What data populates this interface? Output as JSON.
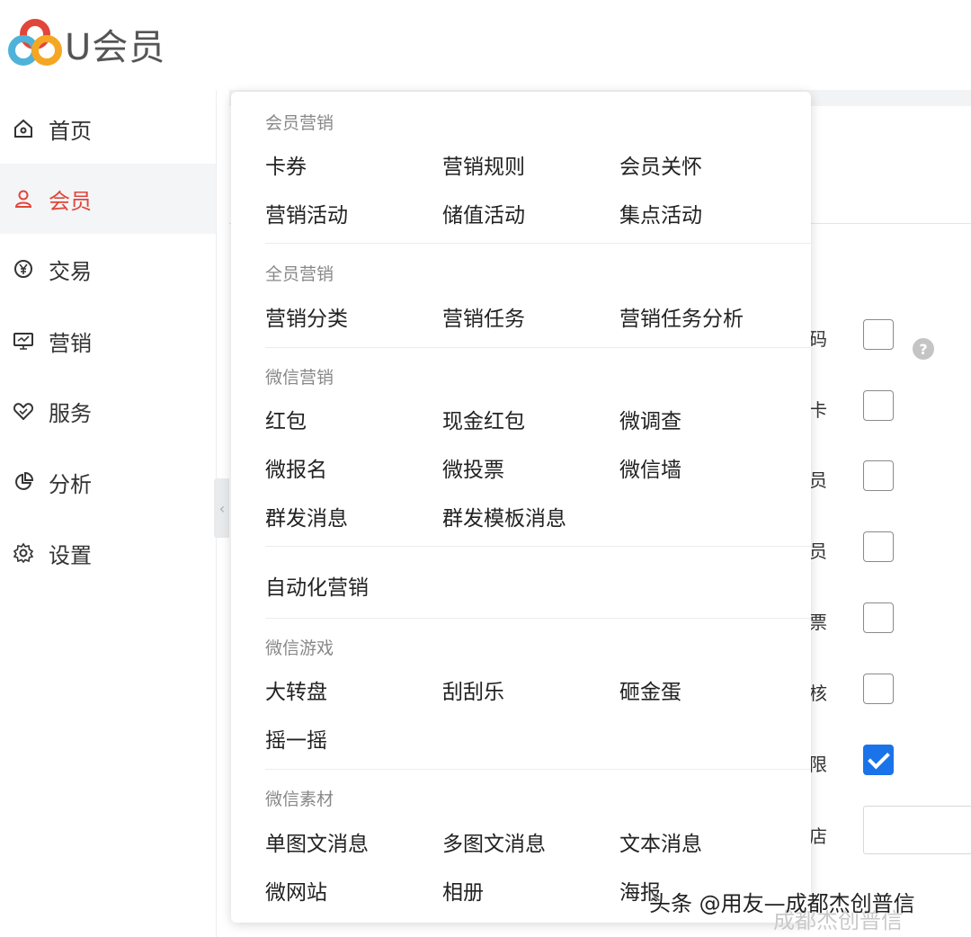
{
  "brand": {
    "name": "U会员"
  },
  "sidebar": {
    "items": [
      {
        "label": "首页",
        "icon": "home-icon"
      },
      {
        "label": "会员",
        "icon": "user-icon",
        "active": true
      },
      {
        "label": "交易",
        "icon": "yen-icon"
      },
      {
        "label": "营销",
        "icon": "monitor-icon"
      },
      {
        "label": "服务",
        "icon": "heart-handshake-icon"
      },
      {
        "label": "分析",
        "icon": "pie-chart-icon"
      },
      {
        "label": "设置",
        "icon": "gear-icon"
      }
    ],
    "collapse_glyph": "‹"
  },
  "form": {
    "rows": [
      {
        "label": "码",
        "checked": false
      },
      {
        "label": "卡",
        "checked": false
      },
      {
        "label": "员",
        "checked": false
      },
      {
        "label": "员",
        "checked": false
      },
      {
        "label": "票",
        "checked": false
      },
      {
        "label": "核",
        "checked": false
      },
      {
        "label": "限",
        "checked": true
      },
      {
        "label": "店"
      }
    ],
    "help_glyph": "?"
  },
  "menu": {
    "sections": {
      "member_marketing": {
        "title": "会员营销",
        "items": [
          "卡券",
          "营销规则",
          "会员关怀",
          "营销活动",
          "储值活动",
          "集点活动"
        ]
      },
      "all_marketing": {
        "title": "全员营销",
        "items": [
          "营销分类",
          "营销任务",
          "营销任务分析"
        ]
      },
      "wechat_marketing": {
        "title": "微信营销",
        "items": [
          "红包",
          "现金红包",
          "微调查",
          "微报名",
          "微投票",
          "微信墙",
          "群发消息",
          "群发模板消息"
        ]
      },
      "automation": {
        "items": [
          "自动化营销"
        ]
      },
      "wechat_games": {
        "title": "微信游戏",
        "items": [
          "大转盘",
          "刮刮乐",
          "砸金蛋",
          "摇一摇"
        ]
      },
      "wechat_assets": {
        "title": "微信素材",
        "items": [
          "单图文消息",
          "多图文消息",
          "文本消息",
          "微网站",
          "相册",
          "海报"
        ]
      }
    }
  },
  "watermark": {
    "text": "头条 @用友—成都杰创普信",
    "shadow_text": "成都杰创普信"
  },
  "colors": {
    "accent": "#e0463a",
    "checkbox_checked": "#1a73e8",
    "logo": [
      "#e0463a",
      "#f5a623",
      "#4fb3d9"
    ]
  }
}
